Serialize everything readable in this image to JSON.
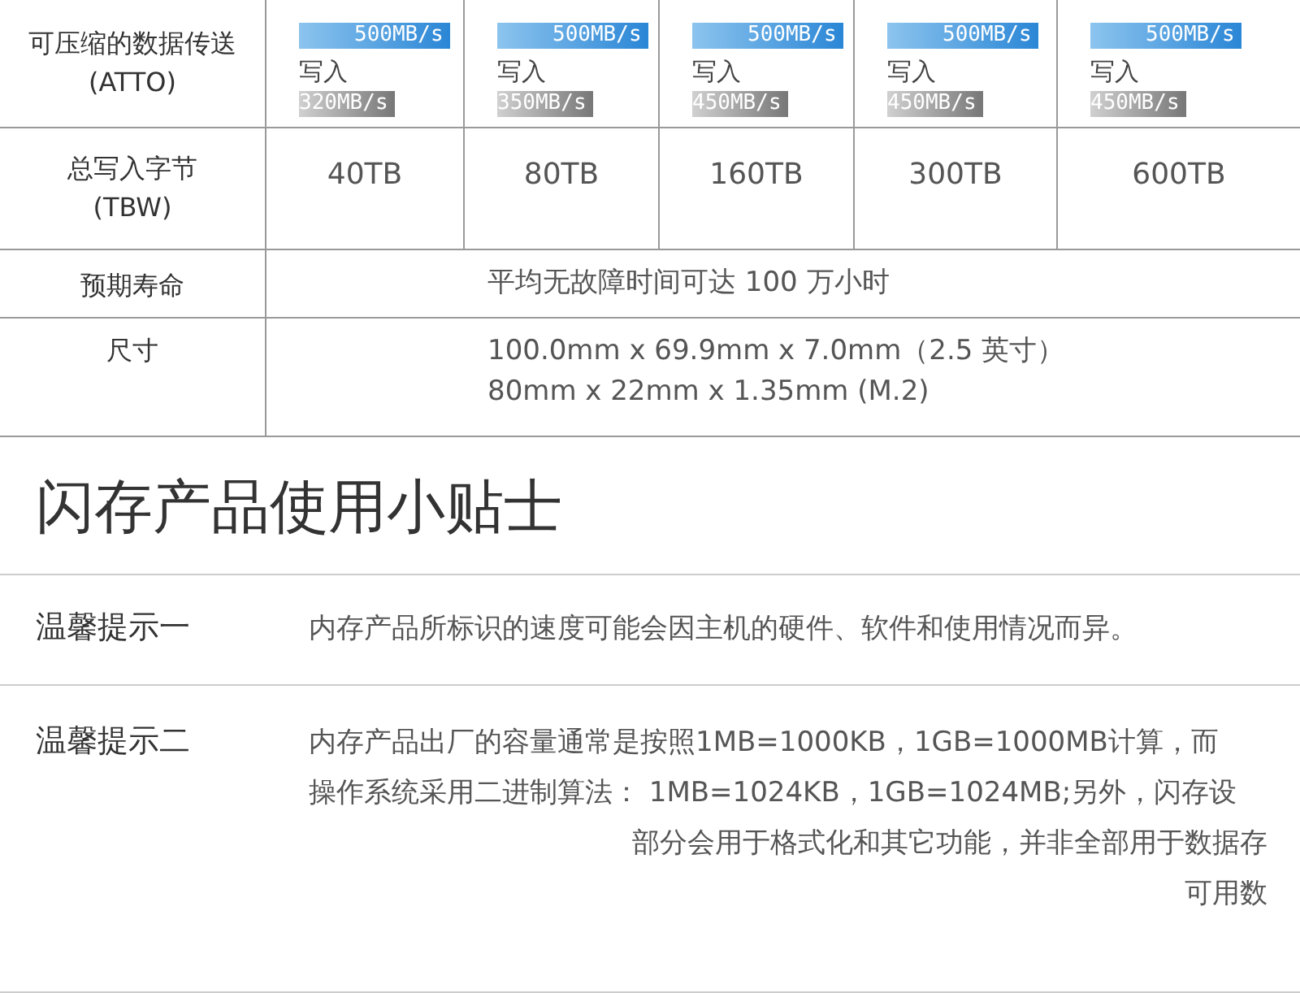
{
  "spec_table": {
    "rows": [
      {
        "kind": "speeds",
        "label": [
          "可压缩的数据传送",
          "(ATTO)"
        ],
        "cells": [
          {
            "read": "500MB/s",
            "write_label": "写入",
            "write": "320MB/s"
          },
          {
            "read": "500MB/s",
            "write_label": "写入",
            "write": "350MB/s"
          },
          {
            "read": "500MB/s",
            "write_label": "写入",
            "write": "450MB/s"
          },
          {
            "read": "500MB/s",
            "write_label": "写入",
            "write": "450MB/s"
          },
          {
            "read": "500MB/s",
            "write_label": "写入",
            "write": "450MB/s"
          }
        ]
      },
      {
        "kind": "values",
        "label": [
          "总写入字节",
          "(TBW)"
        ],
        "cells": [
          "40TB",
          "80TB",
          "160TB",
          "300TB",
          "600TB"
        ]
      },
      {
        "kind": "span",
        "label": [
          "预期寿命"
        ],
        "lines": [
          "平均无故障时间可达 100 万小时"
        ]
      },
      {
        "kind": "span",
        "label": [
          "尺寸"
        ],
        "lines": [
          "100.0mm x 69.9mm x 7.0mm（2.5 英寸）",
          "80mm x 22mm x 1.35mm (M.2)"
        ]
      }
    ]
  },
  "tips": {
    "title": "闪存产品使用小贴士",
    "items": [
      {
        "label": "温馨提示一",
        "lines": [
          {
            "text": "内存产品所标识的速度可能会因主机的硬件、软件和使用情况而异。",
            "partial": false
          }
        ]
      },
      {
        "label": "温馨提示二",
        "lines": [
          {
            "text": "内存产品出厂的容量通常是按照1MB=1000KB，1GB=1000MB计算，而",
            "partial": false
          },
          {
            "text": "操作系统采用二进制算法：  1MB=1024KB，1GB=1024MB;另外，闪存设",
            "partial": false
          },
          {
            "text": "部分会用于格式化和其它功能，并非全部用于数据存",
            "partial": true
          },
          {
            "text": "可用数",
            "partial": true
          }
        ]
      }
    ]
  }
}
